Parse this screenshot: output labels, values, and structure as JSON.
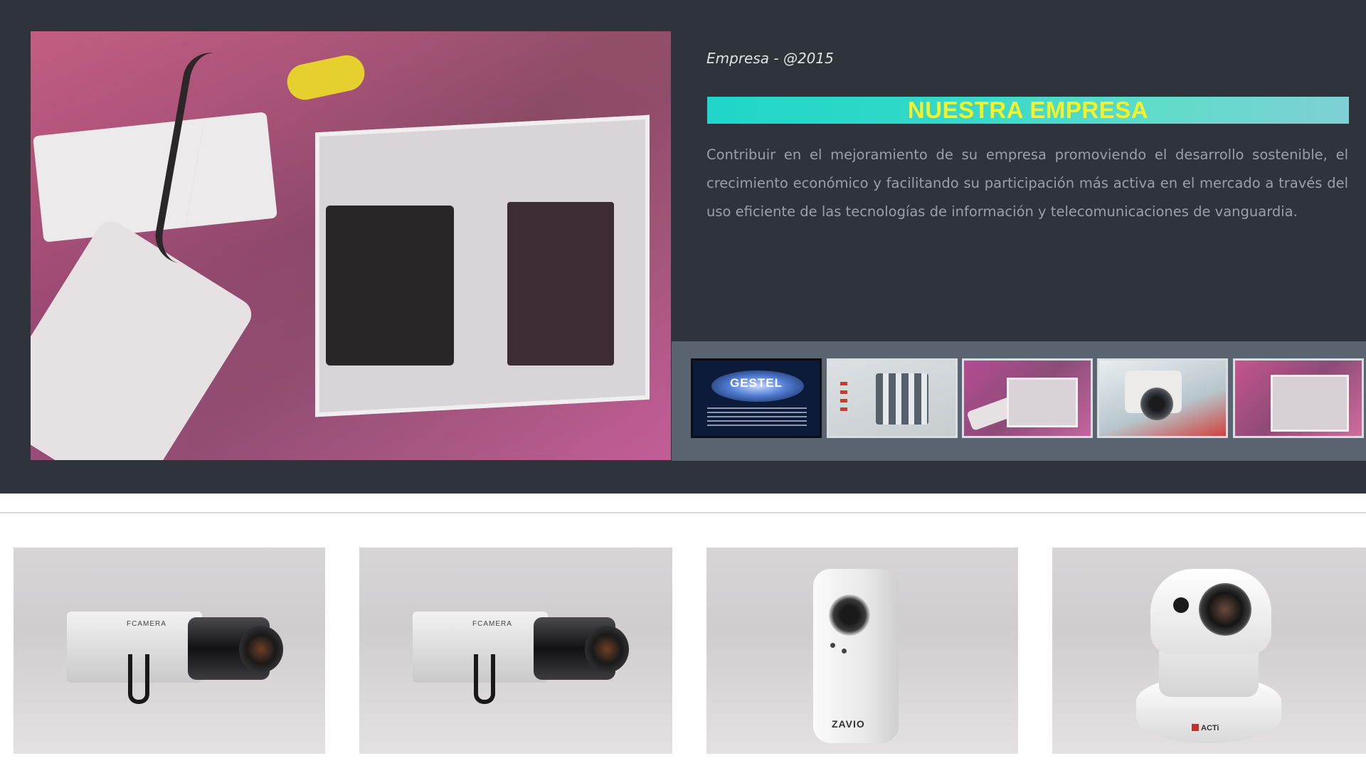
{
  "about": {
    "kicker": "Empresa - @2015",
    "title": "NUESTRA EMPRESA",
    "description": "Contribuir en el mejoramiento de su empresa promoviendo el desarrollo sostenible, el crecimiento económico y facilitando su participación más activa en el mercado a través del uso eficiente de las tecnologías de información y telecomunicaciones de vanguardia."
  },
  "gallery": {
    "thumbnails": [
      {
        "name": "gestel-logo",
        "logo_text": "GESTEL",
        "active": true
      },
      {
        "name": "alarm-keypad",
        "active": false
      },
      {
        "name": "alarm-panel-wiring",
        "active": false
      },
      {
        "name": "ptz-camera",
        "active": false
      },
      {
        "name": "alarm-panel-wiring-2",
        "active": false
      }
    ]
  },
  "products": [
    {
      "name": "box-camera-1",
      "icon": "box-camera-icon",
      "label_text": "FCAMERA"
    },
    {
      "name": "box-camera-2",
      "icon": "box-camera-icon",
      "label_text": "FCAMERA"
    },
    {
      "name": "cube-camera",
      "icon": "cube-camera-icon",
      "brand": "ZAVIO"
    },
    {
      "name": "ptz-camera",
      "icon": "ptz-camera-icon",
      "brand": "ACTi"
    }
  ],
  "colors": {
    "band": "#2e333c",
    "title_text": "#f4f02a",
    "title_bar_start": "#1fd6c8",
    "thumb_strip": "#5a6470"
  }
}
